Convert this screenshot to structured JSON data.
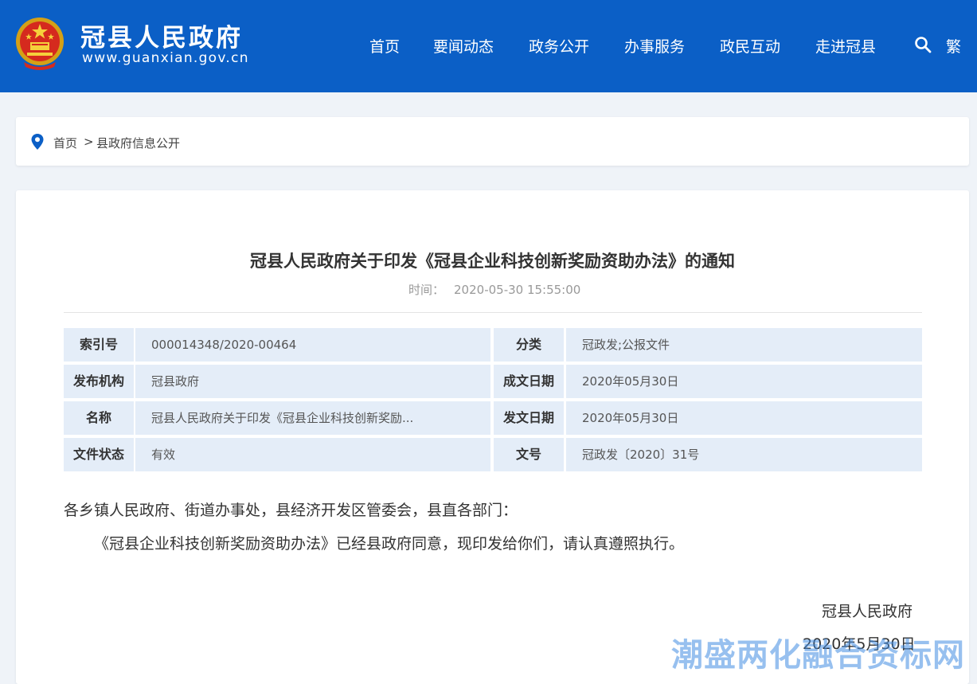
{
  "header": {
    "site_title": "冠县人民政府",
    "site_url": "www.guanxian.gov.cn",
    "nav": [
      "首页",
      "要闻动态",
      "政务公开",
      "办事服务",
      "政民互动",
      "走进冠县"
    ],
    "traditional_label": "繁",
    "icons": {
      "search": "search-icon",
      "emblem": "national-emblem-icon"
    },
    "colors": {
      "header_bg": "#0b5fc6",
      "page_bg": "#eff3f8",
      "table_bg": "#e4edf8"
    }
  },
  "breadcrumb": {
    "home": "首页",
    "separator": ">",
    "current": "县政府信息公开"
  },
  "article": {
    "title": "冠县人民政府关于印发《冠县企业科技创新奖励资助办法》的通知",
    "time_label": "时间：",
    "time_value": "2020-05-30 15:55:00",
    "meta": [
      {
        "label": "索引号",
        "value": "000014348/2020-00464",
        "label2": "分类",
        "value2": "冠政发;公报文件"
      },
      {
        "label": "发布机构",
        "value": "冠县政府",
        "label2": "成文日期",
        "value2": "2020年05月30日"
      },
      {
        "label": "名称",
        "value": "冠县人民政府关于印发《冠县企业科技创新奖励...",
        "label2": "发文日期",
        "value2": "2020年05月30日"
      },
      {
        "label": "文件状态",
        "value": "有效",
        "label2": "文号",
        "value2": "冠政发〔2020〕31号"
      }
    ],
    "salutation": "各乡镇人民政府、街道办事处，县经济开发区管委会，县直各部门：",
    "paragraph": "《冠县企业科技创新奖励资助办法》已经县政府同意，现印发给你们，请认真遵照执行。",
    "signature": "冠县人民政府",
    "sign_date": "2020年5月30日"
  },
  "watermark": "潮盛两化融合资标网"
}
